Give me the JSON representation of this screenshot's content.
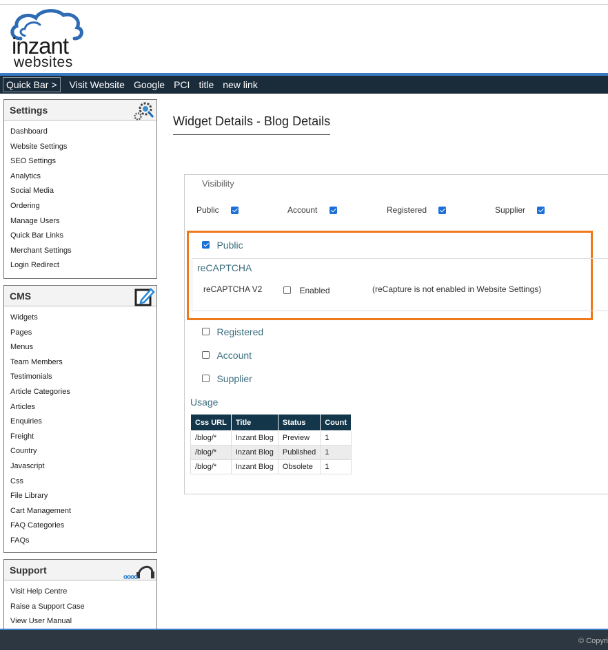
{
  "brand": {
    "line1": "inzant",
    "line2": "websites"
  },
  "quickbar": {
    "label": "Quick Bar >",
    "links": [
      "Visit Website",
      "Google",
      "PCI",
      "title",
      "new link"
    ]
  },
  "sidebar": {
    "settings": {
      "title": "Settings",
      "items": [
        "Dashboard",
        "Website Settings",
        "SEO Settings",
        "Analytics",
        "Social Media",
        "Ordering",
        "Manage Users",
        "Quick Bar Links",
        "Merchant Settings",
        "Login Redirect"
      ]
    },
    "cms": {
      "title": "CMS",
      "items": [
        "Widgets",
        "Pages",
        "Menus",
        "Team Members",
        "Testimonials",
        "Article Categories",
        "Articles",
        "Enquiries",
        "Freight",
        "Country",
        "Javascript",
        "Css",
        "File Library",
        "Cart Management",
        "FAQ Categories",
        "FAQs"
      ]
    },
    "support": {
      "title": "Support",
      "items": [
        "Visit Help Centre",
        "Raise a Support Case",
        "View User Manual"
      ]
    }
  },
  "main": {
    "title": "Widget Details - Blog Details",
    "visibility": {
      "legend": "Visibility",
      "options": [
        {
          "label": "Public",
          "checked": true
        },
        {
          "label": "Account",
          "checked": true
        },
        {
          "label": "Registered",
          "checked": true
        },
        {
          "label": "Supplier",
          "checked": true
        }
      ]
    },
    "sections": {
      "public": {
        "label": "Public",
        "checked": true
      },
      "recaptcha": {
        "heading": "reCAPTCHA",
        "field": "reCAPTCHA V2",
        "enabled_label": "Enabled",
        "note": "(reCapture is not enabled in Website Settings)"
      },
      "registered": {
        "label": "Registered",
        "checked": false
      },
      "account": {
        "label": "Account",
        "checked": false
      },
      "supplier": {
        "label": "Supplier",
        "checked": false
      }
    },
    "usage": {
      "heading": "Usage",
      "columns": [
        "Css URL",
        "Title",
        "Status",
        "Count"
      ],
      "rows": [
        [
          "/blog/*",
          "Inzant Blog",
          "Preview",
          "1"
        ],
        [
          "/blog/*",
          "Inzant Blog",
          "Published",
          "1"
        ],
        [
          "/blog/*",
          "Inzant Blog",
          "Obsolete",
          "1"
        ]
      ]
    }
  },
  "footer": {
    "text": "© Copyri"
  },
  "colors": {
    "highlight": "#f07a1a",
    "navbar": "#1a2b3a",
    "accent": "#3a7cc4",
    "table_header": "#13364a"
  }
}
